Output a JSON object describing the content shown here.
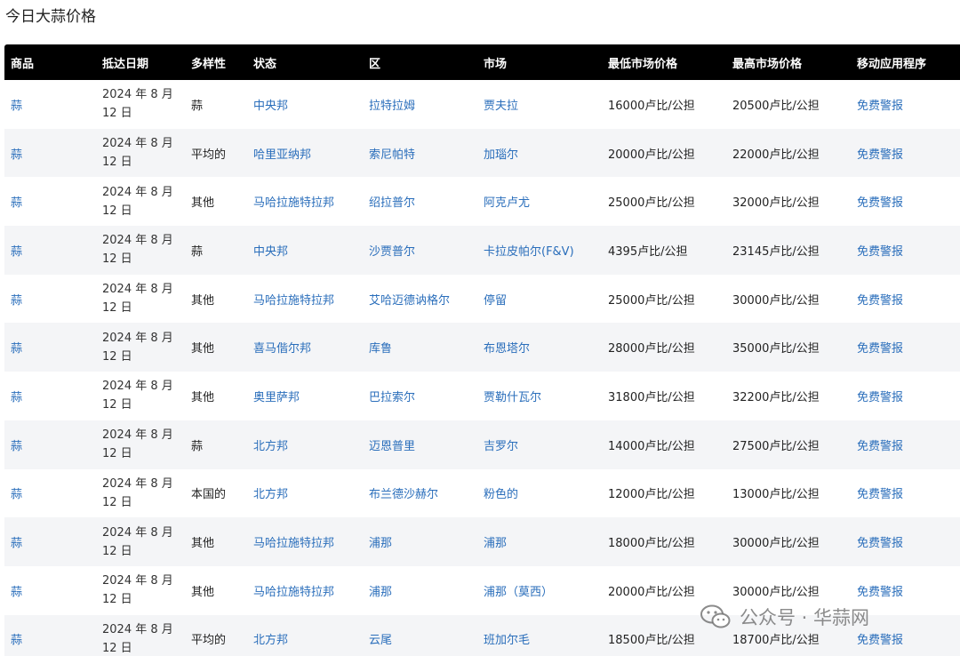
{
  "page": {
    "title": "今日大蒜价格"
  },
  "table": {
    "headers": [
      "商品",
      "抵达日期",
      "多样性",
      "状态",
      "区",
      "市场",
      "最低市场价格",
      "最高市场价格",
      "移动应用程序"
    ],
    "rows": [
      {
        "commodity": "蒜",
        "date": "2024 年 8 月 12 日",
        "variety": "蒜",
        "state": "中央邦",
        "district": "拉特拉姆",
        "market": "贾夫拉",
        "min_price": "16000卢比/公担",
        "max_price": "20500卢比/公担",
        "app": "免费警报"
      },
      {
        "commodity": "蒜",
        "date": "2024 年 8 月 12 日",
        "variety": "平均的",
        "state": "哈里亚纳邦",
        "district": "索尼帕特",
        "market": "加瑙尔",
        "min_price": "20000卢比/公担",
        "max_price": "22000卢比/公担",
        "app": "免费警报"
      },
      {
        "commodity": "蒜",
        "date": "2024 年 8 月 12 日",
        "variety": "其他",
        "state": "马哈拉施特拉邦",
        "district": "绍拉普尔",
        "market": "阿克卢尤",
        "min_price": "25000卢比/公担",
        "max_price": "32000卢比/公担",
        "app": "免费警报"
      },
      {
        "commodity": "蒜",
        "date": "2024 年 8 月 12 日",
        "variety": "蒜",
        "state": "中央邦",
        "district": "沙贾普尔",
        "market": "卡拉皮帕尔(F&V)",
        "min_price": "4395卢比/公担",
        "max_price": "23145卢比/公担",
        "app": "免费警报"
      },
      {
        "commodity": "蒜",
        "date": "2024 年 8 月 12 日",
        "variety": "其他",
        "state": "马哈拉施特拉邦",
        "district": "艾哈迈德讷格尔",
        "market": "停留",
        "min_price": "25000卢比/公担",
        "max_price": "30000卢比/公担",
        "app": "免费警报"
      },
      {
        "commodity": "蒜",
        "date": "2024 年 8 月 12 日",
        "variety": "其他",
        "state": "喜马偕尔邦",
        "district": "库鲁",
        "market": "布恩塔尔",
        "min_price": "28000卢比/公担",
        "max_price": "35000卢比/公担",
        "app": "免费警报"
      },
      {
        "commodity": "蒜",
        "date": "2024 年 8 月 12 日",
        "variety": "其他",
        "state": "奥里萨邦",
        "district": "巴拉索尔",
        "market": "贾勒什瓦尔",
        "min_price": "31800卢比/公担",
        "max_price": "32200卢比/公担",
        "app": "免费警报"
      },
      {
        "commodity": "蒜",
        "date": "2024 年 8 月 12 日",
        "variety": "蒜",
        "state": "北方邦",
        "district": "迈恩普里",
        "market": "吉罗尔",
        "min_price": "14000卢比/公担",
        "max_price": "27500卢比/公担",
        "app": "免费警报"
      },
      {
        "commodity": "蒜",
        "date": "2024 年 8 月 12 日",
        "variety": "本国的",
        "state": "北方邦",
        "district": "布兰德沙赫尔",
        "market": "粉色的",
        "min_price": "12000卢比/公担",
        "max_price": "13000卢比/公担",
        "app": "免费警报"
      },
      {
        "commodity": "蒜",
        "date": "2024 年 8 月 12 日",
        "variety": "其他",
        "state": "马哈拉施特拉邦",
        "district": "浦那",
        "market": "浦那",
        "min_price": "18000卢比/公担",
        "max_price": "30000卢比/公担",
        "app": "免费警报"
      },
      {
        "commodity": "蒜",
        "date": "2024 年 8 月 12 日",
        "variety": "其他",
        "state": "马哈拉施特拉邦",
        "district": "浦那",
        "market": "浦那（莫西）",
        "min_price": "20000卢比/公担",
        "max_price": "30000卢比/公担",
        "app": "免费警报"
      },
      {
        "commodity": "蒜",
        "date": "2024 年 8 月 12 日",
        "variety": "平均的",
        "state": "北方邦",
        "district": "云尾",
        "market": "班加尔毛",
        "min_price": "18500卢比/公担",
        "max_price": "18700卢比/公担",
        "app": "免费警报"
      }
    ]
  },
  "watermark": {
    "text": "公众号 · 华蒜网",
    "icon": "wechat-icon"
  },
  "colors": {
    "header_bg": "#000000",
    "link": "#2a6ebb",
    "stripe": "#f4f5f7"
  }
}
